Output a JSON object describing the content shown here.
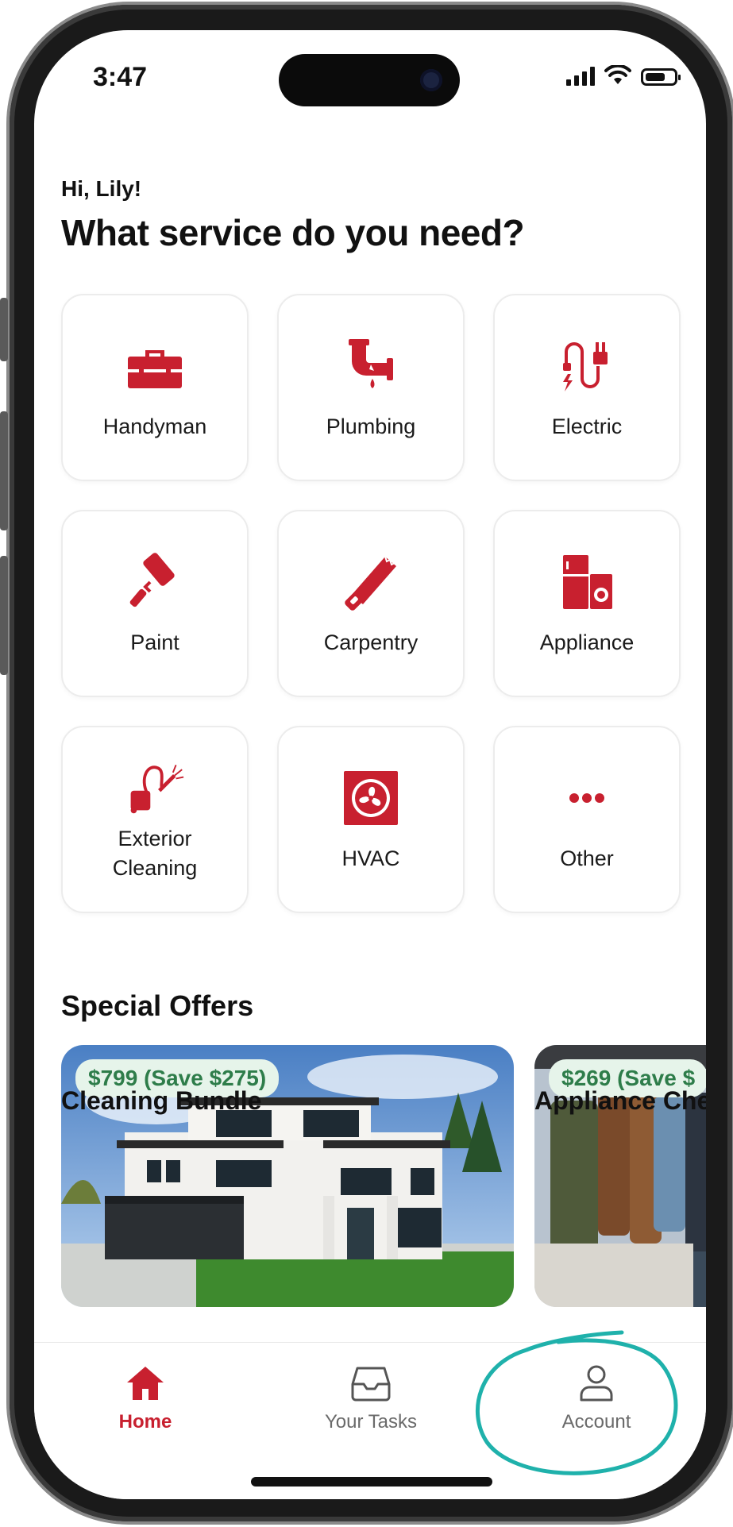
{
  "status_bar": {
    "time": "3:47"
  },
  "greeting": "Hi, Lily!",
  "headline": "What service do you need?",
  "services": [
    {
      "label": "Handyman",
      "icon": "toolbox-icon"
    },
    {
      "label": "Plumbing",
      "icon": "leaking-pipe-icon"
    },
    {
      "label": "Electric",
      "icon": "plug-cord-icon"
    },
    {
      "label": "Paint",
      "icon": "paint-roller-icon"
    },
    {
      "label": "Carpentry",
      "icon": "saw-icon"
    },
    {
      "label": "Appliance",
      "icon": "fridge-washer-icon"
    },
    {
      "label": "Exterior\nCleaning",
      "icon": "pressure-washer-icon"
    },
    {
      "label": "HVAC",
      "icon": "fan-icon"
    },
    {
      "label": "Other",
      "icon": "more-dots-icon"
    }
  ],
  "special_offers": {
    "title": "Special Offers",
    "items": [
      {
        "price": "$799 (Save $275)",
        "title": "Cleaning Bundle"
      },
      {
        "price": "$269 (Save $",
        "title": "Appliance Che"
      }
    ]
  },
  "tab_bar": {
    "items": [
      {
        "label": "Home",
        "icon": "home-icon",
        "active": true
      },
      {
        "label": "Your Tasks",
        "icon": "inbox-tray-icon",
        "active": false
      },
      {
        "label": "Account",
        "icon": "person-icon",
        "active": false
      }
    ]
  },
  "colors": {
    "brand_red": "#c8202f",
    "offer_green": "#2e7d4a",
    "offer_badge_bg": "#e6f4ea",
    "annotation_teal": "#1fb1ab"
  }
}
